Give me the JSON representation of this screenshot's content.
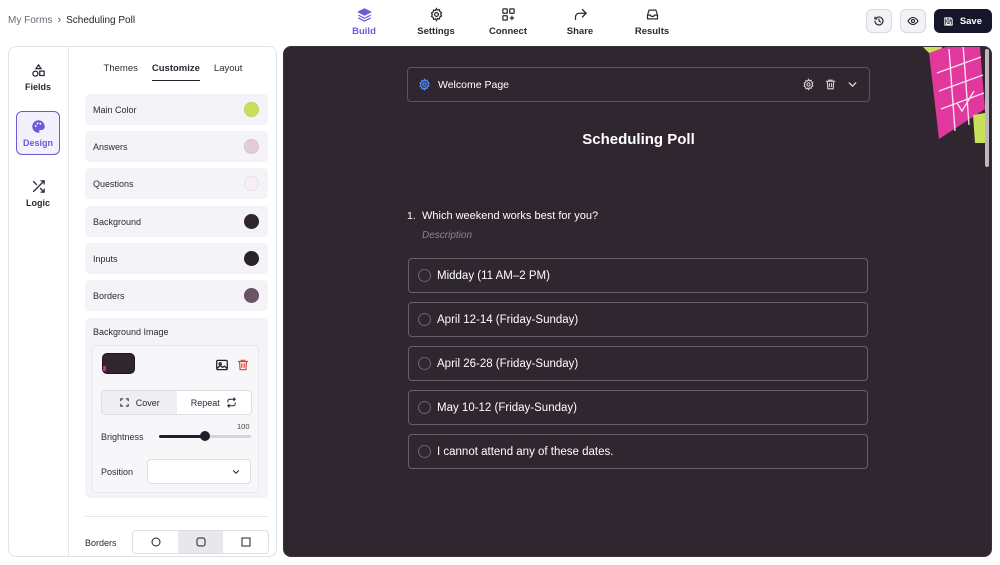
{
  "breadcrumb": {
    "root": "My Forms",
    "separator": "›",
    "current": "Scheduling Poll"
  },
  "nav_tabs": [
    {
      "label": "Build",
      "icon": "layers-icon",
      "active": true
    },
    {
      "label": "Settings",
      "icon": "gear-icon",
      "active": false
    },
    {
      "label": "Connect",
      "icon": "grid-plus-icon",
      "active": false
    },
    {
      "label": "Share",
      "icon": "share-arrow-icon",
      "active": false
    },
    {
      "label": "Results",
      "icon": "inbox-icon",
      "active": false
    }
  ],
  "top_actions": {
    "history_icon": "history-icon",
    "preview_icon": "eye-icon",
    "save_label": "Save",
    "save_icon": "floppy-disk-icon"
  },
  "rail": [
    {
      "label": "Fields",
      "icon": "shapes-icon",
      "active": false
    },
    {
      "label": "Design",
      "icon": "palette-icon",
      "active": true
    },
    {
      "label": "Logic",
      "icon": "shuffle-icon",
      "active": false
    }
  ],
  "design_tabs": [
    {
      "label": "Themes",
      "active": false
    },
    {
      "label": "Customize",
      "active": true
    },
    {
      "label": "Layout",
      "active": false
    }
  ],
  "colors": [
    {
      "label": "Main Color",
      "value": "#c8e05a"
    },
    {
      "label": "Answers",
      "value": "#e3cdd8"
    },
    {
      "label": "Questions",
      "value": "#f6eff3"
    },
    {
      "label": "Background",
      "value": "#2f2630"
    },
    {
      "label": "Inputs",
      "value": "#2a2329"
    },
    {
      "label": "Borders",
      "value": "#6a5566"
    }
  ],
  "background_image": {
    "title": "Background Image",
    "fit_options": [
      {
        "label": "Cover",
        "icon": "expand-icon",
        "selected": false
      },
      {
        "label": "Repeat",
        "icon": "repeat-icon",
        "selected": true
      }
    ],
    "brightness_label": "Brightness",
    "brightness_value": "100",
    "brightness_level": 1.0,
    "position_label": "Position",
    "position_value": ""
  },
  "borders": {
    "label": "Borders",
    "options": [
      {
        "shape": "circle-icon",
        "selected": false
      },
      {
        "shape": "rounded-square-icon",
        "selected": true
      },
      {
        "shape": "square-icon",
        "selected": false
      }
    ]
  },
  "preview": {
    "background": "#2f2630",
    "accent": "#c8e05a",
    "welcome_title": "Welcome Page",
    "form_title": "Scheduling Poll",
    "question_number": "1.",
    "question_text": "Which weekend works best for you?",
    "question_description": "Description",
    "options": [
      "Midday (11 AM–2 PM)",
      "April 12-14 (Friday-Sunday)",
      "April 26-28 (Friday-Sunday)",
      "May 10-12 (Friday-Sunday)",
      "I cannot attend any of these dates."
    ]
  }
}
